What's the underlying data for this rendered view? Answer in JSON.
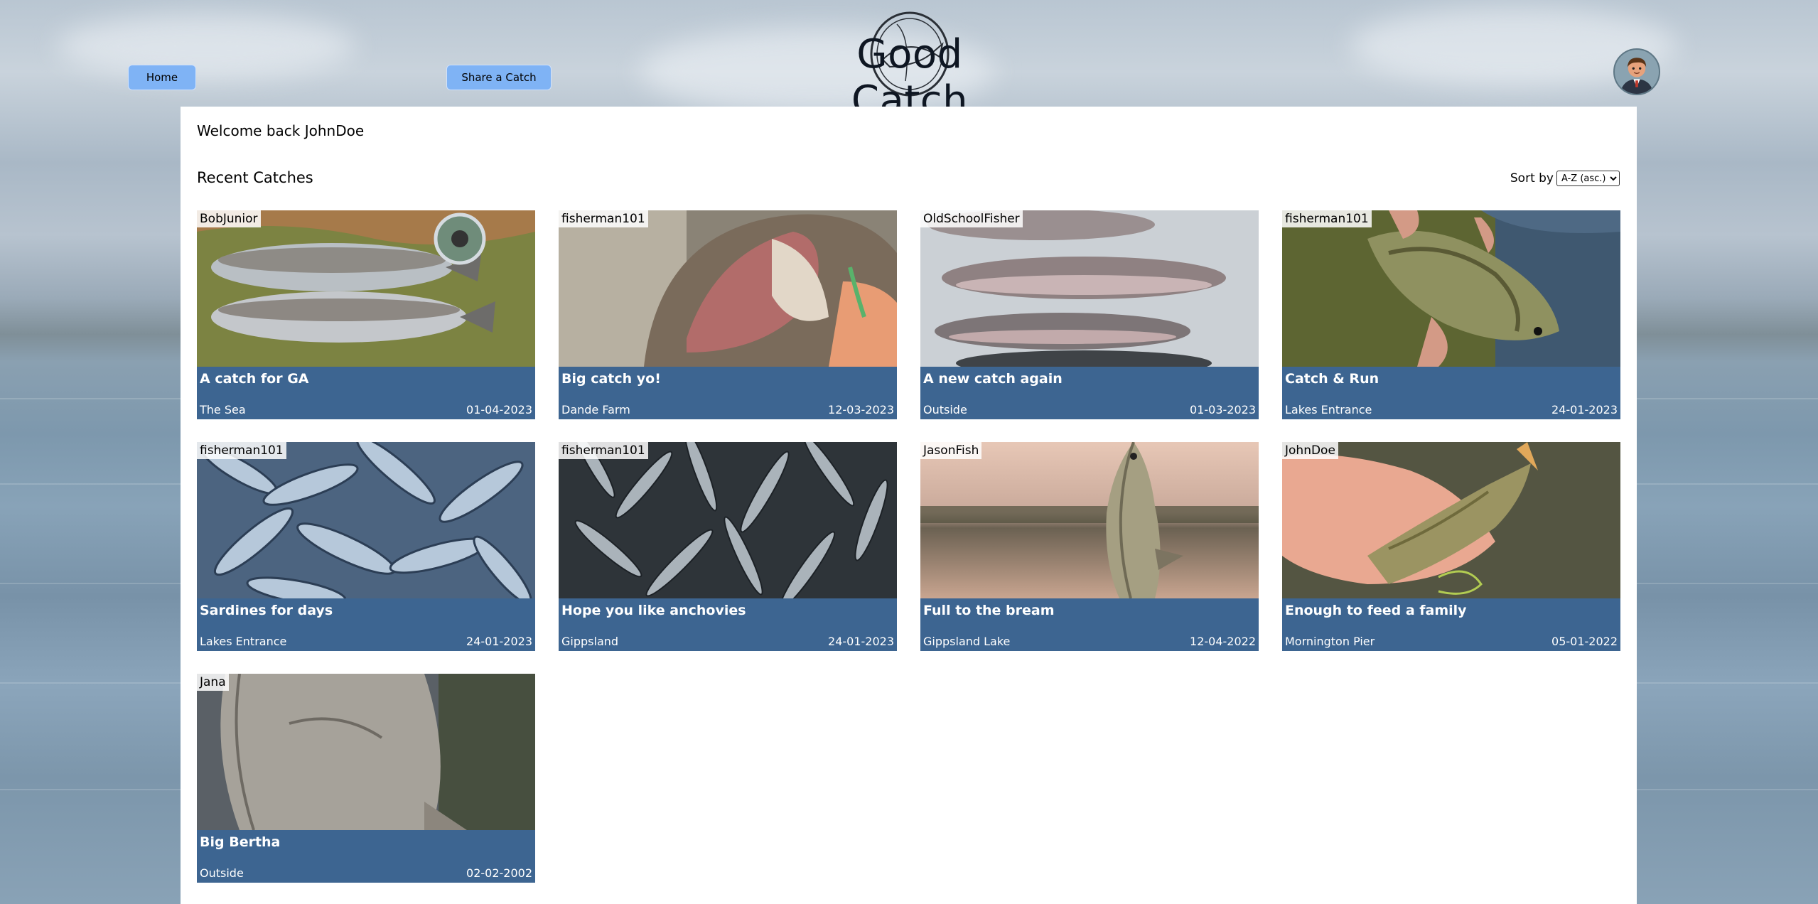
{
  "app": {
    "logo_text": "Good Catch",
    "nav": {
      "home_label": "Home",
      "share_label": "Share a Catch"
    }
  },
  "main": {
    "welcome": "Welcome back JohnDoe",
    "section_title": "Recent Catches",
    "sort": {
      "label": "Sort by",
      "selected": "A-Z (asc.)"
    },
    "catches": [
      {
        "user": "BobJunior",
        "title": "A catch for GA",
        "location": "The Sea",
        "date": "01-04-2023"
      },
      {
        "user": "fisherman101",
        "title": "Big catch yo!",
        "location": "Dande Farm",
        "date": "12-03-2023"
      },
      {
        "user": "OldSchoolFisher",
        "title": "A new catch again",
        "location": "Outside",
        "date": "01-03-2023"
      },
      {
        "user": "fisherman101",
        "title": "Catch & Run",
        "location": "Lakes Entrance",
        "date": "24-01-2023"
      },
      {
        "user": "fisherman101",
        "title": "Sardines for days",
        "location": "Lakes Entrance",
        "date": "24-01-2023"
      },
      {
        "user": "fisherman101",
        "title": "Hope you like anchovies",
        "location": "Gippsland",
        "date": "24-01-2023"
      },
      {
        "user": "JasonFish",
        "title": "Full to the bream",
        "location": "Gippsland Lake",
        "date": "12-04-2022"
      },
      {
        "user": "JohnDoe",
        "title": "Enough to feed a family",
        "location": "Mornington Pier",
        "date": "05-01-2022"
      },
      {
        "user": "Jana",
        "title": "Big Bertha",
        "location": "Outside",
        "date": "02-02-2002"
      }
    ]
  },
  "colors": {
    "nav_button": "#7fb3f5",
    "card_info": "#3d6591"
  },
  "icons": {
    "logo": "fish-circle-icon",
    "avatar": "user-avatar-icon"
  }
}
